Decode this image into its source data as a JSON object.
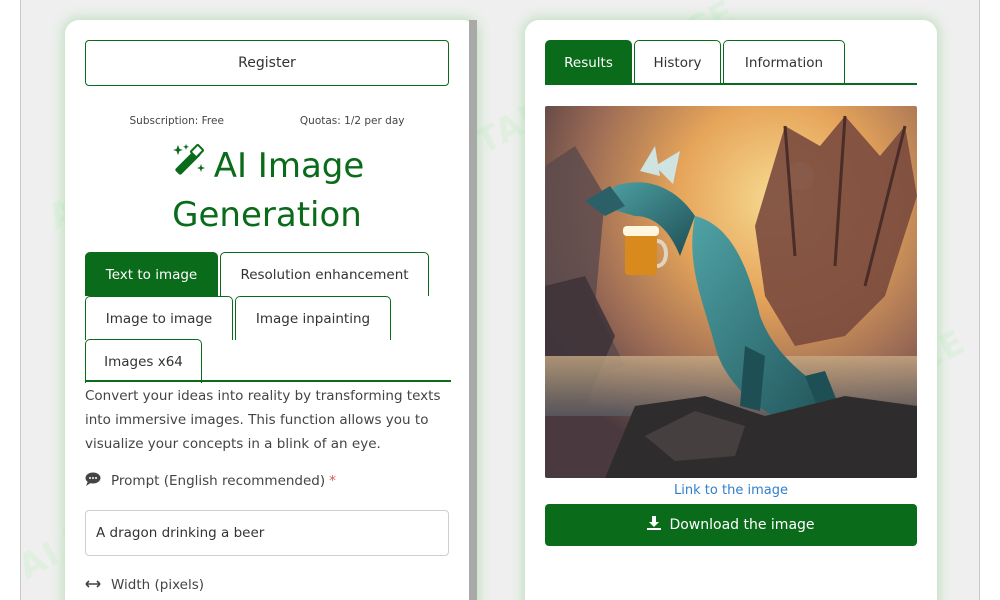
{
  "watermark": {
    "text": "AI TALENT SPACE"
  },
  "left_panel": {
    "register_label": "Register",
    "subscription_text": "Subscription: Free",
    "quotas_text": "Quotas: 1/2 per day",
    "title_line1": "AI Image",
    "title_line2": "Generation",
    "tabs": [
      {
        "label": "Text to image",
        "active": true
      },
      {
        "label": "Resolution enhancement",
        "active": false
      },
      {
        "label": "Image to image",
        "active": false
      },
      {
        "label": "Image inpainting",
        "active": false
      },
      {
        "label": "Images x64",
        "active": false
      }
    ],
    "description": "Convert your ideas into reality by transforming texts into immersive images. This function allows you to visualize your concepts in a blink of an eye.",
    "prompt_label": "Prompt (English recommended)",
    "prompt_required_mark": "*",
    "prompt_value": "A dragon drinking a beer",
    "width_label": "Width (pixels)"
  },
  "right_panel": {
    "tabs": [
      {
        "label": "Results",
        "active": true
      },
      {
        "label": "History",
        "active": false
      },
      {
        "label": "Information",
        "active": false
      }
    ],
    "image_icon": "dragon-drinking-beer-image",
    "link_text": "Link to the image",
    "download_label": "Download the image"
  },
  "colors": {
    "brand_green": "#0a6b1a",
    "link_blue": "#2f7fc9",
    "required_red": "#d9534f",
    "background": "#eeefee"
  }
}
